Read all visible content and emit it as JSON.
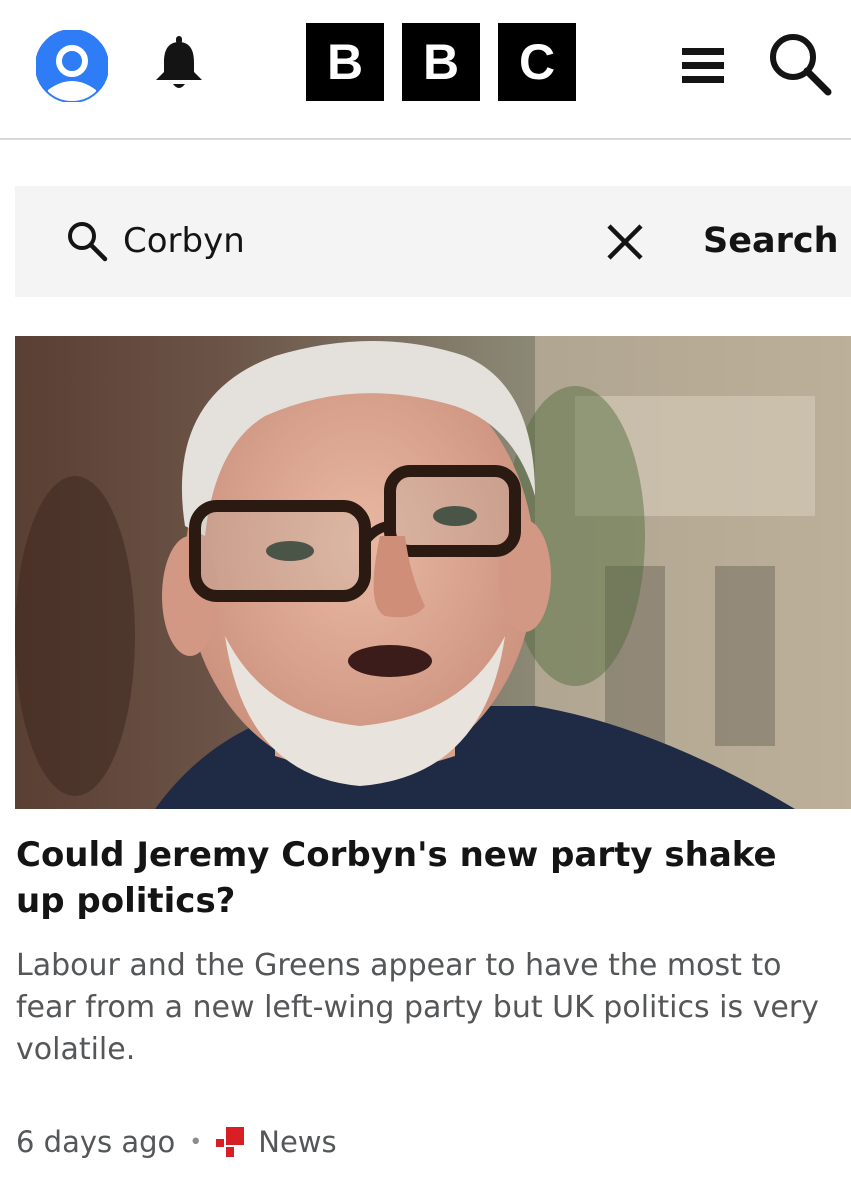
{
  "header": {
    "logo_letters": [
      "B",
      "B",
      "C"
    ],
    "icons": [
      "account-icon",
      "bell-icon",
      "menu-icon",
      "search-icon"
    ]
  },
  "search": {
    "query": "Corbyn",
    "button_label": "Search",
    "icons": [
      "search-icon",
      "close-icon"
    ]
  },
  "article": {
    "headline": "Could Jeremy Corbyn's new party shake up politics?",
    "summary": "Labour and the Greens appear to have the most to fear from a new left-wing party but UK politics is very volatile.",
    "timestamp": "6 days ago",
    "category": "News",
    "image_subject": "photo-of-man-with-glasses"
  },
  "colors": {
    "account_blue": "#2e7cf6",
    "news_red": "#d81f26",
    "text_dark": "#141414",
    "text_grey": "#545658",
    "search_bg": "#f4f4f4"
  }
}
